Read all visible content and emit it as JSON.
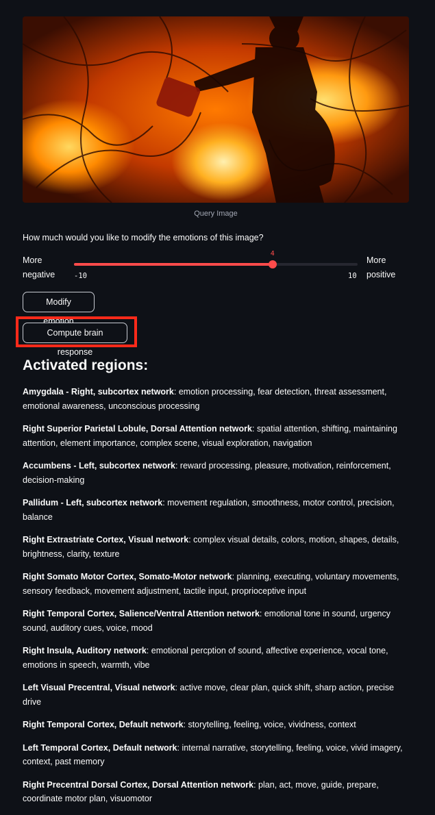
{
  "image": {
    "caption": "Query Image"
  },
  "question": "How much would you like to modify the emotions of this image?",
  "slider": {
    "left_label_line1": "More",
    "left_label_line2": "negative",
    "right_label_line1": "More",
    "right_label_line2": "positive",
    "min_label": "-10",
    "max_label": "10",
    "min": -10,
    "max": 10,
    "value": 4,
    "value_label": "4",
    "accent_color": "#ff4b4b"
  },
  "buttons": {
    "modify_label": "Modify emotion",
    "compute_label": "Compute brain response"
  },
  "heading": "Activated regions:",
  "regions": [
    {
      "name": "Amygdala - Right, subcortex network",
      "desc": ": emotion processing, fear detection, threat assessment, emotional awareness, unconscious processing"
    },
    {
      "name": "Right Superior Parietal Lobule, Dorsal Attention network",
      "desc": ": spatial attention, shifting, maintaining attention, element importance, complex scene, visual exploration, navigation"
    },
    {
      "name": "Accumbens - Left, subcortex network",
      "desc": ": reward processing, pleasure, motivation, reinforcement, decision-making"
    },
    {
      "name": "Pallidum - Left, subcortex network",
      "desc": ": movement regulation, smoothness, motor control, precision, balance"
    },
    {
      "name": "Right Extrastriate Cortex, Visual network",
      "desc": ": complex visual details, colors, motion, shapes, details, brightness, clarity, texture"
    },
    {
      "name": "Right Somato Motor Cortex, Somato-Motor network",
      "desc": ": planning, executing, voluntary movements, sensory feedback, movement adjustment, tactile input, proprioceptive input"
    },
    {
      "name": "Right Temporal Cortex, Salience/Ventral Attention network",
      "desc": ": emotional tone in sound, urgency sound, auditory cues, voice, mood"
    },
    {
      "name": "Right Insula, Auditory network",
      "desc": ": emotional percption of sound, affective experience, vocal tone, emotions in speech, warmth, vibe"
    },
    {
      "name": "Left Visual Precentral, Visual network",
      "desc": ": active move, clear plan, quick shift, sharp action, precise drive"
    },
    {
      "name": "Right Temporal Cortex, Default network",
      "desc": ": storytelling, feeling, voice, vividness, context"
    },
    {
      "name": "Left Temporal Cortex, Default network",
      "desc": ": internal narrative, storytelling, feeling, voice, vivid imagery, context, past memory"
    },
    {
      "name": "Right Precentral Dorsal Cortex, Dorsal Attention network",
      "desc": ": plan, act, move, guide, prepare, coordinate motor plan, visuomotor"
    }
  ]
}
